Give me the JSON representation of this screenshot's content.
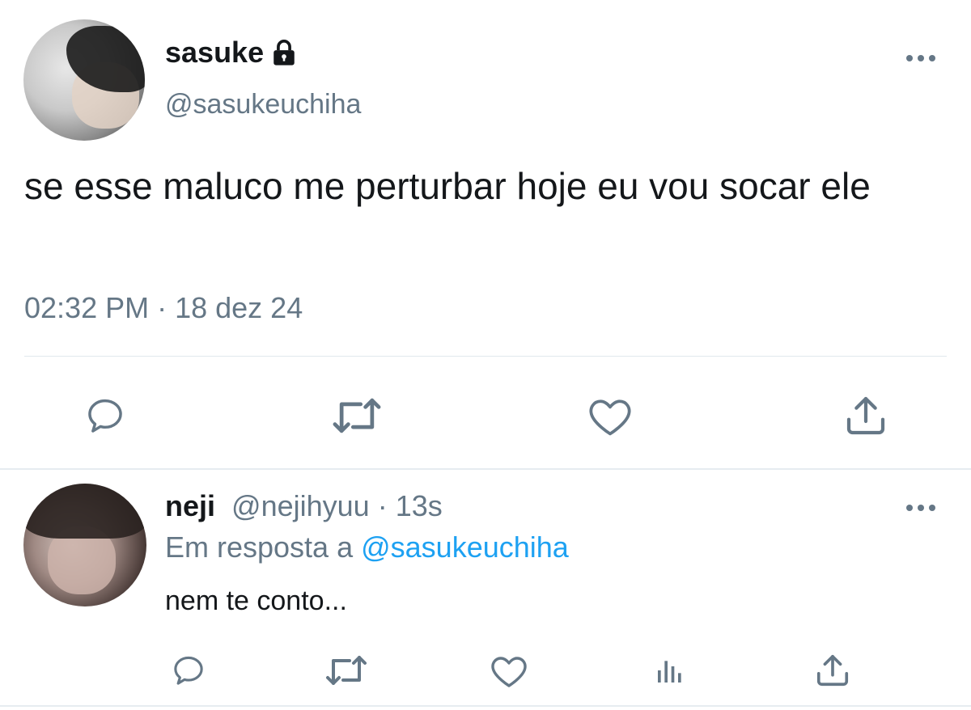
{
  "main_tweet": {
    "display_name": "sasuke",
    "handle": "@sasukeuchiha",
    "text": "se esse maluco me perturbar hoje eu vou socar ele",
    "timestamp": "02:32 PM · 18 dez 24",
    "icons": {
      "protected": "lock-icon",
      "more": "more-icon",
      "actions": [
        "reply-icon",
        "retweet-icon",
        "like-icon",
        "share-icon"
      ]
    }
  },
  "reply_tweet": {
    "display_name": "neji",
    "handle": "@nejihyuu",
    "separator": " · ",
    "time": "13s",
    "reply_prefix": "Em resposta a ",
    "reply_mention": "@sasukeuchiha",
    "text": "nem te conto...",
    "icons": {
      "more": "more-icon",
      "actions": [
        "reply-icon",
        "retweet-icon",
        "like-icon",
        "analytics-icon",
        "share-icon"
      ]
    }
  },
  "colors": {
    "text": "#14171a",
    "secondary": "#657786",
    "link": "#1da1f2",
    "divider": "#e1e8ed"
  }
}
